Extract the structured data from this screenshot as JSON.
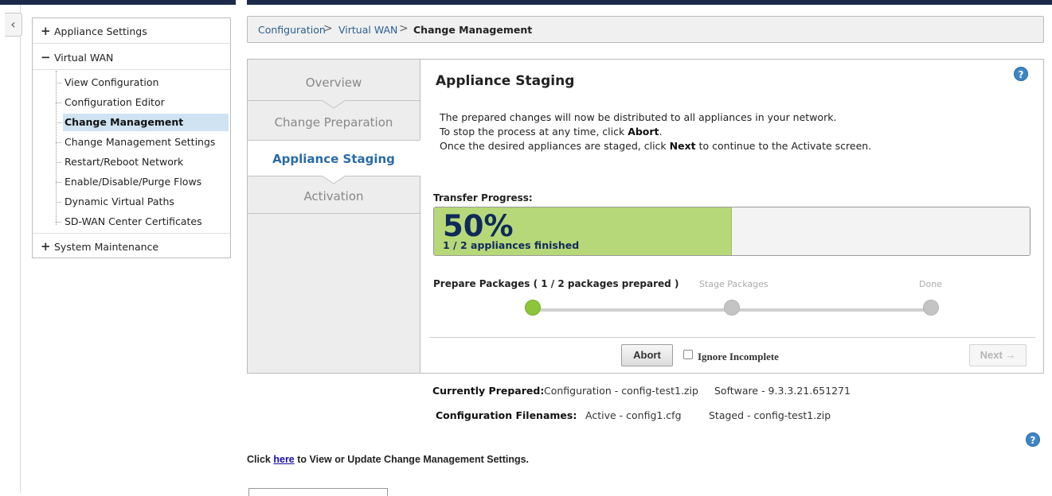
{
  "sidebar": {
    "sections": [
      {
        "sign": "+",
        "label": "Appliance Settings"
      },
      {
        "sign": "−",
        "label": "Virtual WAN"
      },
      {
        "sign": "+",
        "label": "System Maintenance"
      }
    ],
    "items": [
      {
        "label": "View Configuration"
      },
      {
        "label": "Configuration Editor"
      },
      {
        "label": "Change Management"
      },
      {
        "label": "Change Management Settings"
      },
      {
        "label": "Restart/Reboot Network"
      },
      {
        "label": "Enable/Disable/Purge Flows"
      },
      {
        "label": "Dynamic Virtual Paths"
      },
      {
        "label": "SD-WAN Center Certificates"
      }
    ],
    "active_item": "Change Management"
  },
  "breadcrumb": {
    "items": [
      "Configuration",
      "Virtual WAN",
      "Change Management"
    ],
    "separator": ">"
  },
  "wizard": {
    "steps": [
      "Overview",
      "Change Preparation",
      "Appliance Staging",
      "Activation"
    ],
    "active_step": "Appliance Staging"
  },
  "staging": {
    "title": "Appliance Staging",
    "help": "?",
    "desc_line1": "The prepared changes will now be distributed to all appliances in your network.",
    "desc_line2_pre": "To stop the process at any time, click ",
    "desc_line2_bold": "Abort",
    "desc_line2_post": ".",
    "desc_line3_pre": "Once the desired appliances are staged, click ",
    "desc_line3_bold": "Next",
    "desc_line3_post": " to continue to the Activate screen.",
    "transfer_label": "Transfer Progress:",
    "progress_value": 0.5,
    "progress_percent": "50%",
    "progress_sub": "1 / 2 appliances finished",
    "prepare_label": "Prepare Packages ( 1 / 2 packages prepared )",
    "stage_label": "Stage Packages",
    "done_label": "Done",
    "abort_label": "Abort",
    "ignore_label": "Ignore Incomplete",
    "next_label": "Next →"
  },
  "info": {
    "currently_prepared_label": "Currently Prepared:",
    "currently_prepared_config": "Configuration - config-test1.zip",
    "currently_prepared_software": "Software - 9.3.3.21.651271",
    "filenames_label": "Configuration Filenames:",
    "active_file": "Active - config1.cfg",
    "staged_file": "Staged - config-test1.zip"
  },
  "footer": {
    "click_pre": "Click ",
    "click_link": "here",
    "click_post": " to View or Update Change Management Settings.",
    "help": "?"
  },
  "colors": {
    "accent": "#2a6aa5",
    "progress_fill": "#b7d878",
    "progress_text": "#0f2a5a",
    "step_done": "#8cc43a",
    "active_item_bg": "#cfe3f2"
  }
}
